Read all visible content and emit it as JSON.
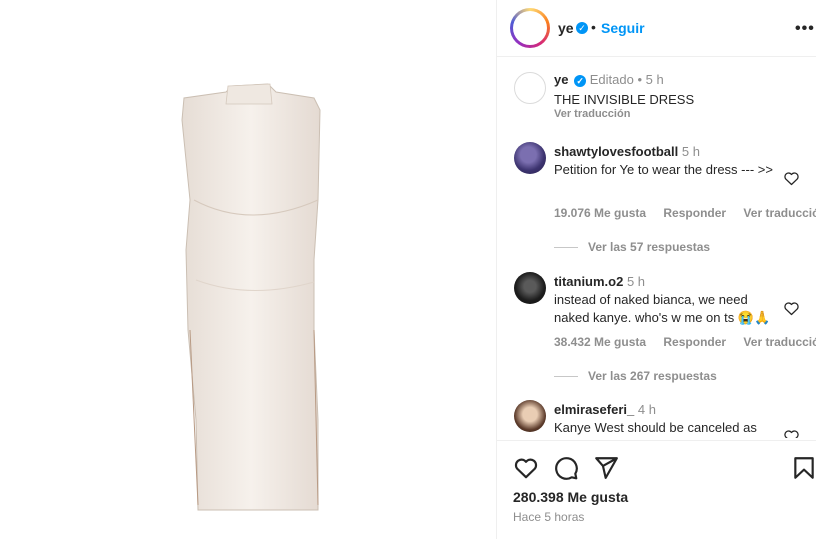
{
  "post": {
    "username": "ye",
    "follow_label": "Seguir",
    "dot": "•",
    "more_icon": "more-options-icon"
  },
  "caption": {
    "username": "ye",
    "edited": "Editado",
    "dot": "•",
    "time": "5 h",
    "text": "THE INVISIBLE DRESS",
    "translate": "Ver traducción"
  },
  "comments": [
    {
      "username": "shawtylovesfootball",
      "time": "5 h",
      "text": "Petition for Ye to wear the dress --- >>",
      "likes": "19.076 Me gusta",
      "reply": "Responder",
      "translate": "Ver traducción",
      "replies": "Ver las 57 respuestas"
    },
    {
      "username": "titanium.o2",
      "time": "5 h",
      "text": "instead of naked bianca, we need naked kanye. who's w me on ts 😭🙏",
      "likes": "38.432 Me gusta",
      "reply": "Responder",
      "translate": "Ver traducción",
      "replies": "Ver las 267 respuestas"
    },
    {
      "username": "elmiraseferi_",
      "time": "4 h",
      "text": "Kanye West should be canceled as"
    }
  ],
  "footer": {
    "likes": "280.398 Me gusta",
    "ago": "Hace 5 horas"
  },
  "colors": {
    "accent": "#0095f6",
    "text": "#262626",
    "secondary": "#8e8e8e",
    "border": "#efefef"
  }
}
